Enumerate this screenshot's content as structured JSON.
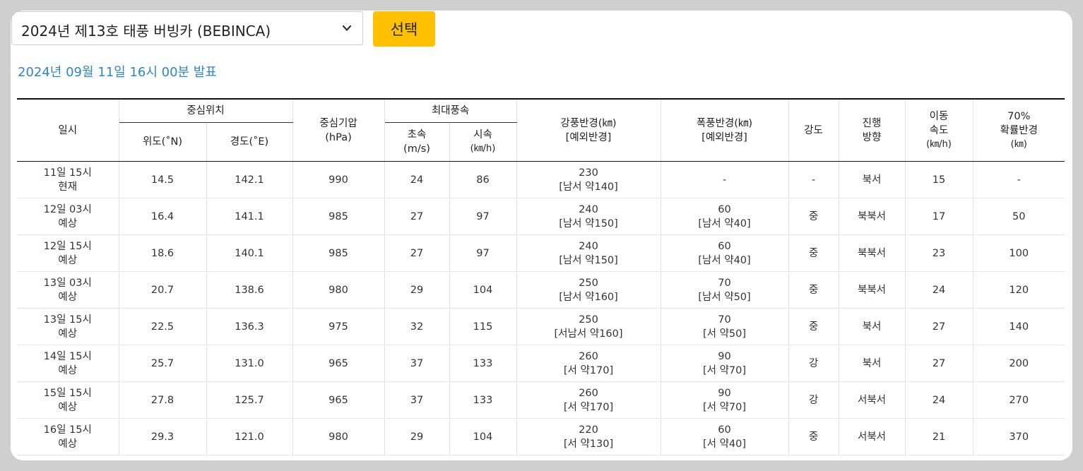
{
  "selector": {
    "value": "2024년 제13호 태풍 버빙카 (BEBINCA)",
    "button_label": "선택"
  },
  "announcement": "2024년 09월 11일 16시 00분 발표",
  "colors": {
    "accent_button": "#ffc000",
    "announcement_text": "#2f86c4"
  },
  "icons": {
    "dropdown": "chevron-down-icon"
  },
  "table": {
    "headers": {
      "datetime": "일시",
      "center": "중심위치",
      "lat": "위도(˚N)",
      "lon": "경도(˚E)",
      "pressure_1": "중심기압",
      "pressure_2": "(hPa)",
      "maxwind": "최대풍속",
      "ms_1": "초속",
      "ms_2": "(m/s)",
      "kmh_1": "시속",
      "kmh_2": "(㎞/h)",
      "strong_1": "강풍반경(㎞)",
      "strong_2": "[예외반경]",
      "storm_1": "폭풍반경(㎞)",
      "storm_2": "[예외반경]",
      "intensity": "강도",
      "dir_1": "진행",
      "dir_2": "방향",
      "speed_1": "이동",
      "speed_2": "속도",
      "speed_3": "(㎞/h)",
      "prob_1": "70%",
      "prob_2": "확률반경",
      "prob_3": "(㎞)"
    },
    "rows": [
      {
        "time": "11일 15시",
        "status": "현재",
        "lat": "14.5",
        "lon": "142.1",
        "pressure": "990",
        "ms": "24",
        "kmh": "86",
        "strong": "230",
        "strong_ex": "[남서 약140]",
        "storm": "-",
        "storm_ex": "",
        "intensity": "-",
        "direction": "북서",
        "speed": "15",
        "prob": "-"
      },
      {
        "time": "12일 03시",
        "status": "예상",
        "lat": "16.4",
        "lon": "141.1",
        "pressure": "985",
        "ms": "27",
        "kmh": "97",
        "strong": "240",
        "strong_ex": "[남서 약150]",
        "storm": "60",
        "storm_ex": "[남서 약40]",
        "intensity": "중",
        "direction": "북북서",
        "speed": "17",
        "prob": "50"
      },
      {
        "time": "12일 15시",
        "status": "예상",
        "lat": "18.6",
        "lon": "140.1",
        "pressure": "985",
        "ms": "27",
        "kmh": "97",
        "strong": "240",
        "strong_ex": "[남서 약150]",
        "storm": "60",
        "storm_ex": "[남서 약40]",
        "intensity": "중",
        "direction": "북북서",
        "speed": "23",
        "prob": "100"
      },
      {
        "time": "13일 03시",
        "status": "예상",
        "lat": "20.7",
        "lon": "138.6",
        "pressure": "980",
        "ms": "29",
        "kmh": "104",
        "strong": "250",
        "strong_ex": "[남서 약160]",
        "storm": "70",
        "storm_ex": "[남서 약50]",
        "intensity": "중",
        "direction": "북북서",
        "speed": "24",
        "prob": "120"
      },
      {
        "time": "13일 15시",
        "status": "예상",
        "lat": "22.5",
        "lon": "136.3",
        "pressure": "975",
        "ms": "32",
        "kmh": "115",
        "strong": "250",
        "strong_ex": "[서남서 약160]",
        "storm": "70",
        "storm_ex": "[서 약50]",
        "intensity": "중",
        "direction": "북서",
        "speed": "27",
        "prob": "140"
      },
      {
        "time": "14일 15시",
        "status": "예상",
        "lat": "25.7",
        "lon": "131.0",
        "pressure": "965",
        "ms": "37",
        "kmh": "133",
        "strong": "260",
        "strong_ex": "[서 약170]",
        "storm": "90",
        "storm_ex": "[서 약70]",
        "intensity": "강",
        "direction": "북서",
        "speed": "27",
        "prob": "200"
      },
      {
        "time": "15일 15시",
        "status": "예상",
        "lat": "27.8",
        "lon": "125.7",
        "pressure": "965",
        "ms": "37",
        "kmh": "133",
        "strong": "260",
        "strong_ex": "[서 약170]",
        "storm": "90",
        "storm_ex": "[서 약70]",
        "intensity": "강",
        "direction": "서북서",
        "speed": "24",
        "prob": "270"
      },
      {
        "time": "16일 15시",
        "status": "예상",
        "lat": "29.3",
        "lon": "121.0",
        "pressure": "980",
        "ms": "29",
        "kmh": "104",
        "strong": "220",
        "strong_ex": "[서 약130]",
        "storm": "60",
        "storm_ex": "[서 약40]",
        "intensity": "중",
        "direction": "서북서",
        "speed": "21",
        "prob": "370"
      }
    ]
  }
}
